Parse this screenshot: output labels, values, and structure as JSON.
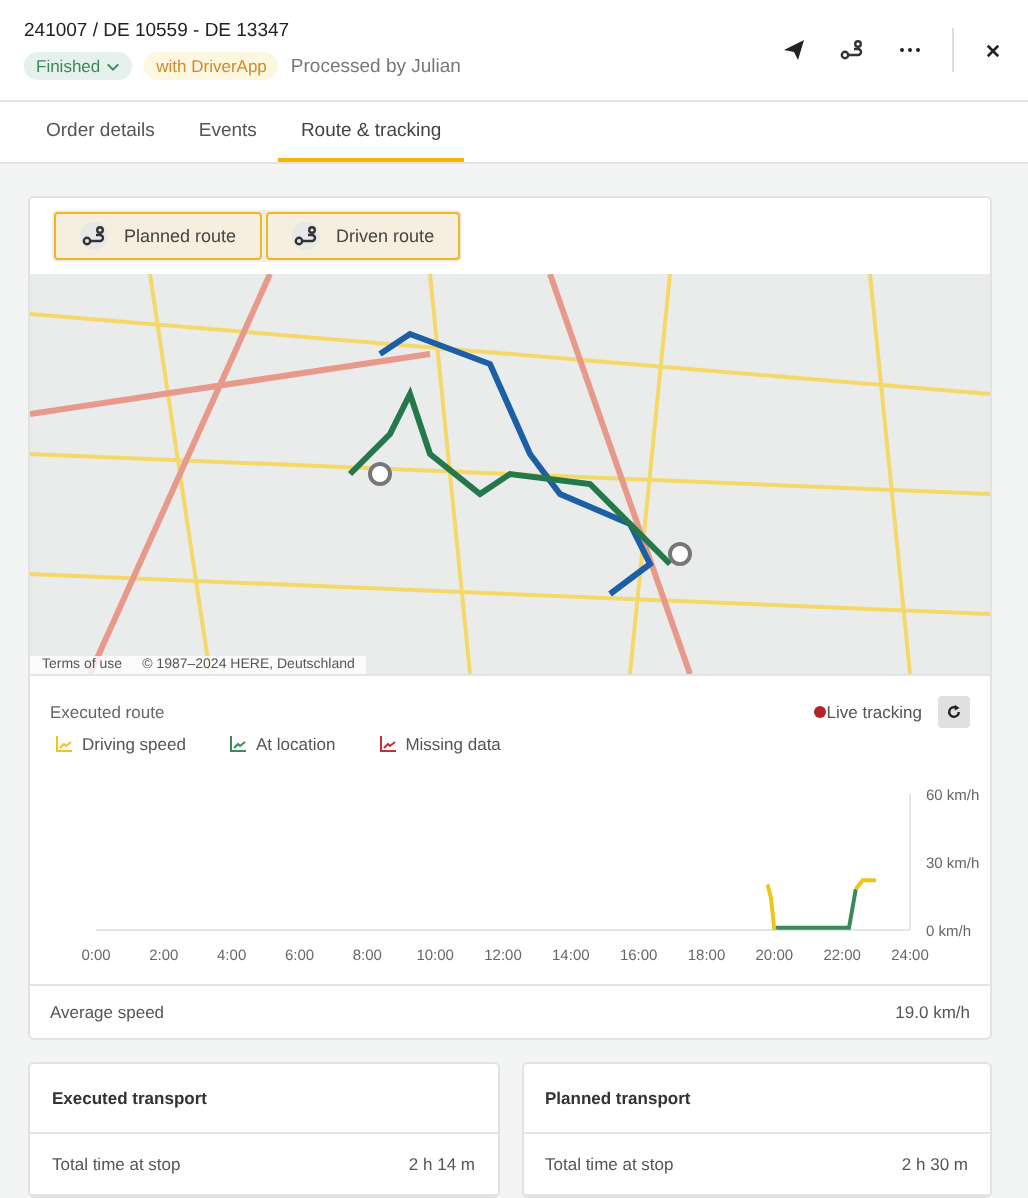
{
  "header": {
    "title": "241007 / DE 10559 - DE 13347",
    "status": "Finished",
    "badge": "with DriverApp",
    "processed_by": "Processed by Julian"
  },
  "tabs": [
    {
      "label": "Order details",
      "selected": false
    },
    {
      "label": "Events",
      "selected": false
    },
    {
      "label": "Route & tracking",
      "selected": true
    }
  ],
  "route_toggles": [
    {
      "label": "Planned route",
      "selected": true
    },
    {
      "label": "Driven route",
      "selected": true
    }
  ],
  "map": {
    "attribution_link": "Terms of use",
    "copyright": "© 1987–2024 HERE, Deutschland"
  },
  "executed_route": {
    "title": "Executed route",
    "live_tracking": "Live tracking",
    "extra_legend": [
      {
        "label": "Missing data",
        "color": "#c0313a"
      }
    ],
    "chart_data": {
      "type": "line",
      "x": [
        19.8,
        19.9,
        20,
        22,
        22.2,
        22.4,
        22.6,
        22.8,
        23.0
      ],
      "series": [
        {
          "name": "Driving speed",
          "color": "#f0c419",
          "values": [
            20,
            14,
            0,
            null,
            null,
            18,
            22,
            22,
            22
          ]
        },
        {
          "name": "At location",
          "color": "#3a8a5c",
          "values": [
            null,
            null,
            1,
            1,
            1,
            18,
            null,
            null,
            null
          ]
        }
      ],
      "xlim": [
        0,
        24
      ],
      "ylim": [
        0,
        60
      ],
      "xticks": [
        {
          "value": 0,
          "label": "0:00"
        },
        {
          "value": 2,
          "label": "2:00"
        },
        {
          "value": 4,
          "label": "4:00"
        },
        {
          "value": 6,
          "label": "6:00"
        },
        {
          "value": 8,
          "label": "8:00"
        },
        {
          "value": 10,
          "label": "10:00"
        },
        {
          "value": 12,
          "label": "12:00"
        },
        {
          "value": 14,
          "label": "14:00"
        },
        {
          "value": 16,
          "label": "16:00"
        },
        {
          "value": 18,
          "label": "18:00"
        },
        {
          "value": 20,
          "label": "20:00"
        },
        {
          "value": 22,
          "label": "22:00"
        },
        {
          "value": 24,
          "label": "24:00"
        }
      ],
      "yticks": [
        {
          "value": 0,
          "label": "0 km/h"
        },
        {
          "value": 30,
          "label": "30 km/h"
        },
        {
          "value": 60,
          "label": "60 km/h"
        }
      ]
    },
    "average_speed": {
      "label": "Average speed",
      "value": "19.0 km/h"
    }
  },
  "transport_cards": [
    {
      "title": "Executed transport",
      "rows": [
        {
          "label": "Total time at stop",
          "value": "2 h 14 m"
        }
      ]
    },
    {
      "title": "Planned transport",
      "rows": [
        {
          "label": "Total time at stop",
          "value": "2 h 30 m"
        }
      ]
    }
  ]
}
